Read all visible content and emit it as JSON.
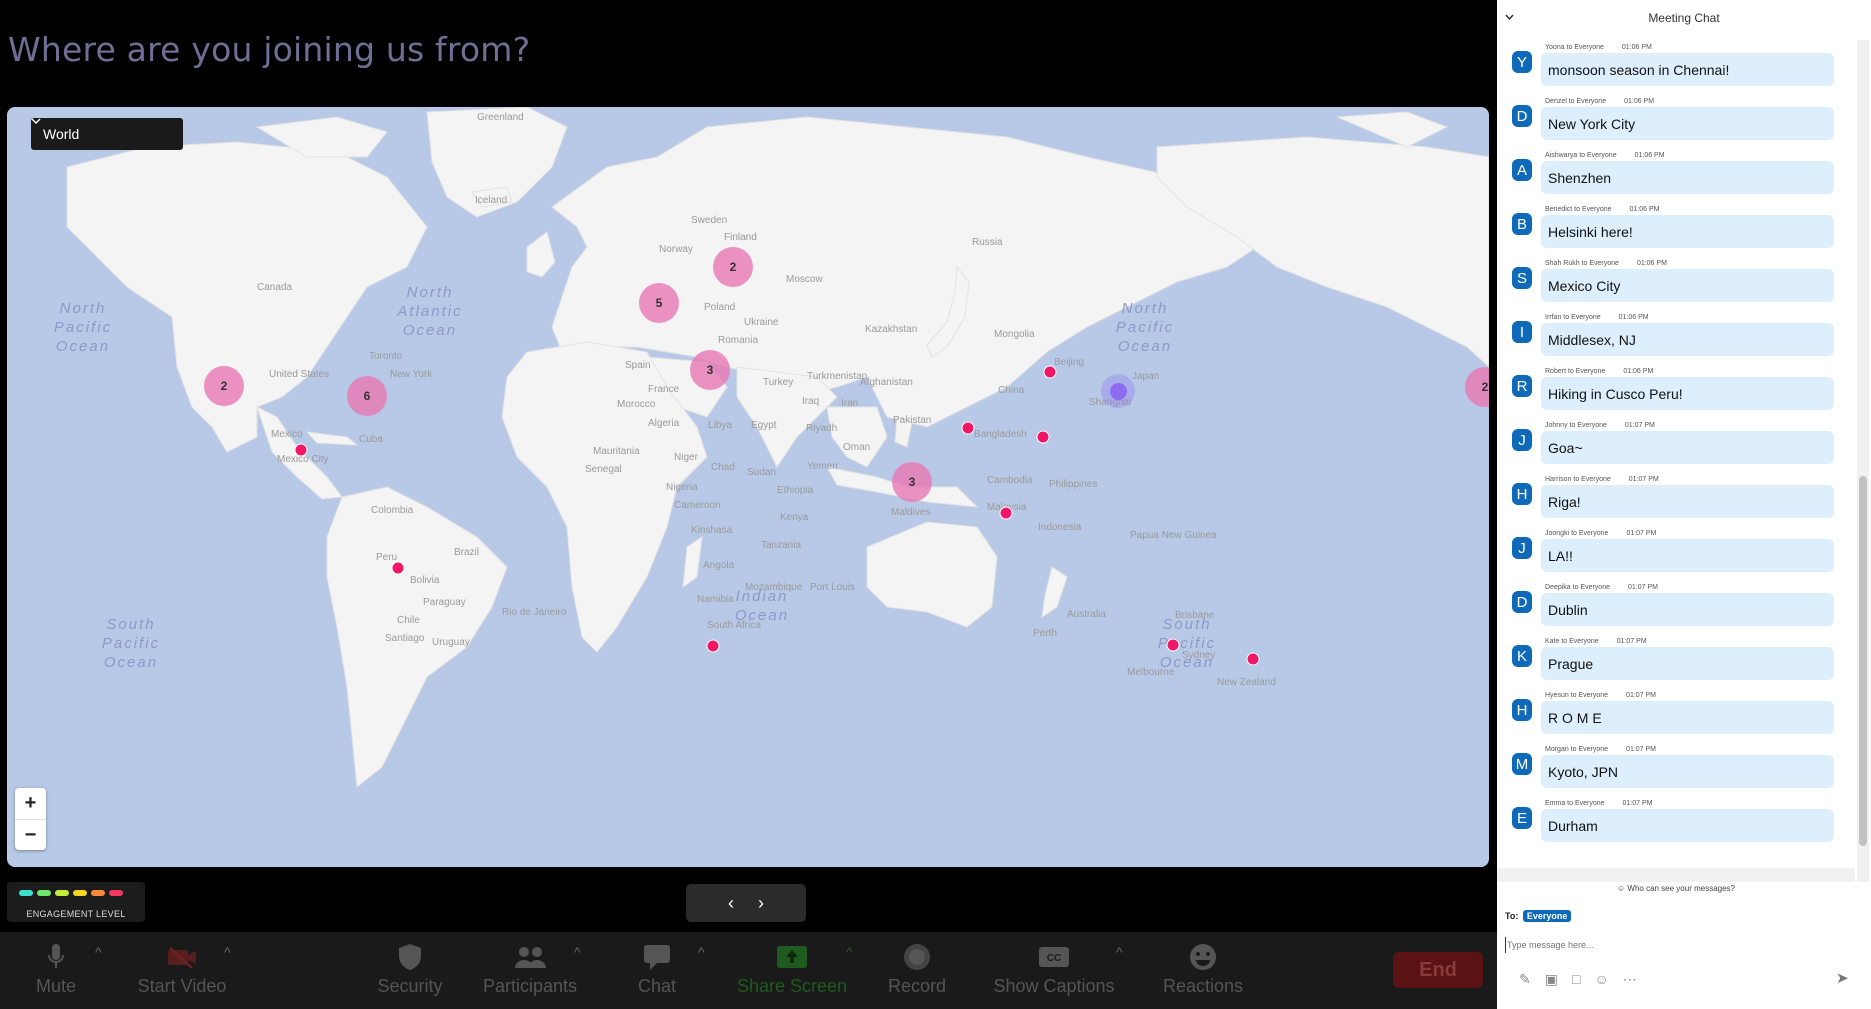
{
  "question": "Where are you joining us from?",
  "map": {
    "region_select": "World",
    "zoom_in": "+",
    "zoom_out": "−",
    "oceans": [
      "North Pacific Ocean",
      "North Atlantic Ocean",
      "North Pacific Ocean",
      "South Pacific Ocean",
      "South Pacific Ocean",
      "Indian Ocean"
    ],
    "places": [
      "Greenland",
      "Iceland",
      "Sweden",
      "Finland",
      "Norway",
      "Russia",
      "Moscow",
      "Canada",
      "Toronto",
      "New York",
      "United States",
      "Mexico",
      "Mexico City",
      "Cuba",
      "Ukraine",
      "Poland",
      "Romania",
      "Kazakhstan",
      "Mongolia",
      "Spain",
      "France",
      "Turkey",
      "Turkmenistan",
      "Beijing",
      "China",
      "Shanghai",
      "Morocco",
      "Algeria",
      "Libya",
      "Egypt",
      "Iraq",
      "Iran",
      "Afghanistan",
      "Pakistan",
      "Riyadh",
      "Oman",
      "Yemen",
      "Bangladesh",
      "Mauritania",
      "Senegal",
      "Niger",
      "Chad",
      "Sudan",
      "Ethiopia",
      "Nigeria",
      "Kenya",
      "Cameroon",
      "Kinshasa",
      "Tanzania",
      "Angola",
      "Namibia",
      "Mozambique",
      "Port Louis",
      "South Africa",
      "Maldives",
      "Cambodia",
      "Philippines",
      "Malaysia",
      "Indonesia",
      "Papua New Guinea",
      "Colombia",
      "Peru",
      "Brazil",
      "Bolivia",
      "Paraguay",
      "Chile",
      "Santiago",
      "Uruguay",
      "Rio de Janeiro",
      "Australia",
      "Perth",
      "Brisbane",
      "Sydney",
      "Melbourne",
      "New Zealand",
      "Japan"
    ],
    "clusters": [
      "2",
      "6",
      "5",
      "2",
      "3",
      "3",
      "2"
    ],
    "colors": {
      "cluster": "#e978b4",
      "pin": "#ef1766",
      "you": "#8e6cf2",
      "ocean": "#b7c9e6",
      "land": "#f4f4f4"
    }
  },
  "engagement": {
    "label": "ENGAGEMENT LEVEL",
    "colors": [
      "#3ee0d0",
      "#6ee86a",
      "#c4ec3b",
      "#f4d523",
      "#f88a3a",
      "#f23a5e"
    ]
  },
  "pager": {
    "prev": "‹",
    "next": "›"
  },
  "toolbar": [
    {
      "icon": "mic-icon",
      "label": "Mute"
    },
    {
      "icon": "video-off-icon",
      "label": "Start Video"
    },
    {
      "icon": "shield-icon",
      "label": "Security"
    },
    {
      "icon": "participants-icon",
      "label": "Participants"
    },
    {
      "icon": "chat-icon",
      "label": "Chat"
    },
    {
      "icon": "share-screen-icon",
      "label": "Share Screen"
    },
    {
      "icon": "record-icon",
      "label": "Record"
    },
    {
      "icon": "cc-icon",
      "label": "Show Captions"
    },
    {
      "icon": "reactions-icon",
      "label": "Reactions"
    }
  ],
  "end_label": "End",
  "chat": {
    "title": "Meeting Chat",
    "messages": [
      {
        "initial": "Y",
        "sender": "Yoona to Everyone",
        "time": "01:06 PM",
        "text": "monsoon season in Chennai!"
      },
      {
        "initial": "D",
        "sender": "Denzel to Everyone",
        "time": "01:06 PM",
        "text": "New York City"
      },
      {
        "initial": "A",
        "sender": "Aishwarya to Everyone",
        "time": "01:06 PM",
        "text": "Shenzhen"
      },
      {
        "initial": "B",
        "sender": "Benedict to Everyone",
        "time": "01:06 PM",
        "text": "Helsinki here!"
      },
      {
        "initial": "S",
        "sender": "Shah Rukh to Everyone",
        "time": "01:06 PM",
        "text": "Mexico City"
      },
      {
        "initial": "I",
        "sender": "Irrfan to Everyone",
        "time": "01:06 PM",
        "text": "Middlesex, NJ"
      },
      {
        "initial": "R",
        "sender": "Robert to Everyone",
        "time": "01:06 PM",
        "text": "Hiking in Cusco Peru!"
      },
      {
        "initial": "J",
        "sender": "Johnny to Everyone",
        "time": "01:07 PM",
        "text": "Goa~"
      },
      {
        "initial": "H",
        "sender": "Harrison to Everyone",
        "time": "01:07 PM",
        "text": "Riga!"
      },
      {
        "initial": "J",
        "sender": "Joongki to Everyone",
        "time": "01:07 PM",
        "text": "LA!!"
      },
      {
        "initial": "D",
        "sender": "Deepika to Everyone",
        "time": "01:07 PM",
        "text": "Dublin"
      },
      {
        "initial": "K",
        "sender": "Kate to Everyone",
        "time": "01:07 PM",
        "text": "Prague"
      },
      {
        "initial": "H",
        "sender": "Hyesun to Everyone",
        "time": "01:07 PM",
        "text": "R O M E"
      },
      {
        "initial": "M",
        "sender": "Morgan to Everyone",
        "time": "01:07 PM",
        "text": "Kyoto, JPN"
      },
      {
        "initial": "E",
        "sender": "Emma to Everyone",
        "time": "01:07 PM",
        "text": "Durham"
      }
    ],
    "who_can_see": "Who can see your messages?",
    "to_label": "To:",
    "to_value": "Everyone",
    "input_placeholder": "Type message here..."
  }
}
